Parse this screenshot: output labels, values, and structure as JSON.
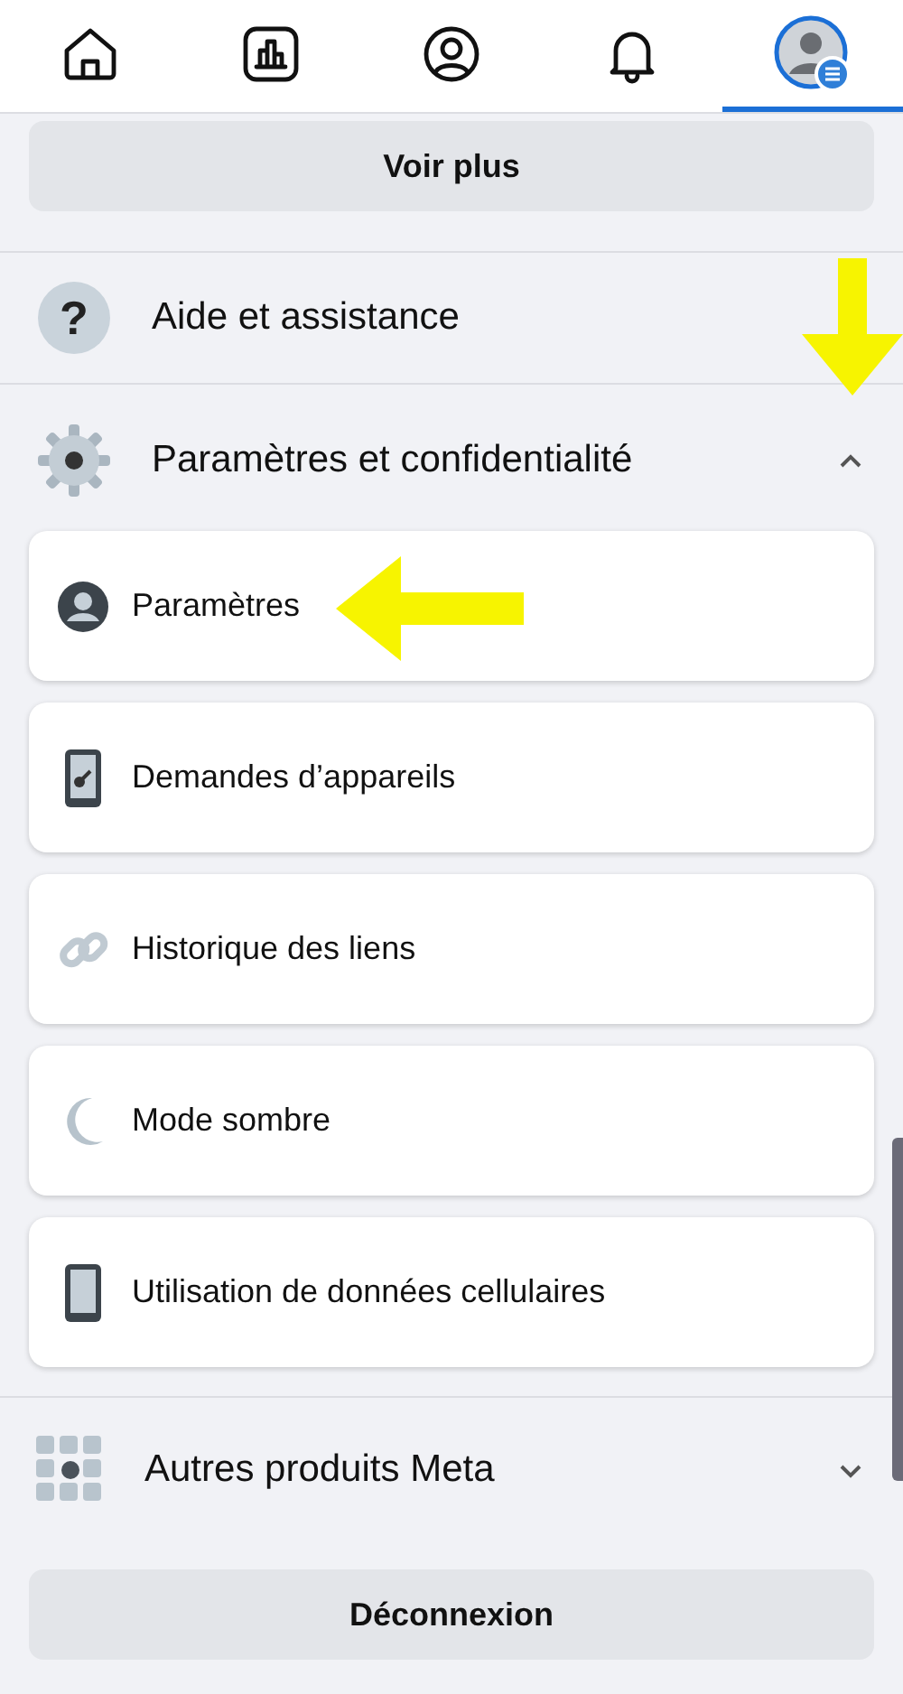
{
  "nav": {
    "tabs": [
      {
        "kind": "home",
        "selected": false
      },
      {
        "kind": "chart",
        "selected": false
      },
      {
        "kind": "profile",
        "selected": false
      },
      {
        "kind": "bell",
        "selected": false
      },
      {
        "kind": "menu",
        "selected": true
      }
    ]
  },
  "see_more": "Voir plus",
  "help": {
    "kind": "help",
    "icon_text": "?",
    "label": "Aide et assistance"
  },
  "settings": {
    "kind": "gear",
    "label": "Paramètres et confidentialité",
    "expanded": true,
    "items": [
      {
        "kind": "account",
        "label": "Paramètres",
        "annotated": true
      },
      {
        "kind": "phone-key",
        "label": "Demandes d’appareils",
        "annotated": false
      },
      {
        "kind": "link",
        "label": "Historique des liens",
        "annotated": false
      },
      {
        "kind": "moon",
        "label": "Mode sombre",
        "annotated": false
      },
      {
        "kind": "phone",
        "label": "Utilisation de données cellulaires",
        "annotated": false
      }
    ]
  },
  "header_annotated": true,
  "meta": {
    "kind": "grid",
    "label": "Autres produits Meta",
    "expanded": false
  },
  "logout": "Déconnexion"
}
